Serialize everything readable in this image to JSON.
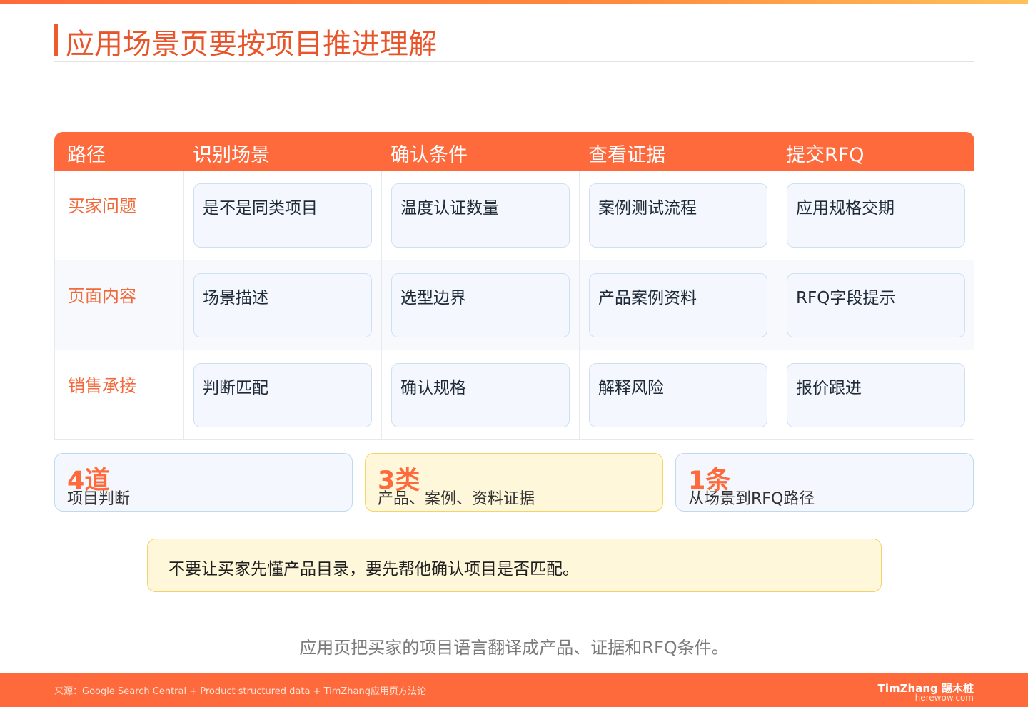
{
  "title": "应用场景页要按项目推进理解",
  "table": {
    "headers": [
      "路径",
      "识别场景",
      "确认条件",
      "查看证据",
      "提交RFQ"
    ],
    "rows": [
      {
        "label": "买家问题",
        "cells": [
          "是不是同类项目",
          "温度认证数量",
          "案例测试流程",
          "应用规格交期"
        ]
      },
      {
        "label": "页面内容",
        "cells": [
          "场景描述",
          "选型边界",
          "产品案例资料",
          "RFQ字段提示"
        ]
      },
      {
        "label": "销售承接",
        "cells": [
          "判断匹配",
          "确认规格",
          "解释风险",
          "报价跟进"
        ]
      }
    ]
  },
  "stats": [
    {
      "number": "4道",
      "desc": "项目判断"
    },
    {
      "number": "3类",
      "desc": "产品、案例、资料证据"
    },
    {
      "number": "1条",
      "desc": "从场景到RFQ路径"
    }
  ],
  "callout": "不要让买家先懂产品目录，要先帮他确认项目是否匹配。",
  "summary": "应用页把买家的项目语言翻译成产品、证据和RFQ条件。",
  "footer": {
    "source": "来源：Google Search Central + Product structured data + TimZhang应用页方法论",
    "brand": "TimZhang 踢木桩",
    "site": "herewow.com"
  },
  "colors": {
    "accent": "#ff6a3d",
    "title": "#e8552a",
    "card_blue": "#f4f8fe",
    "card_yellow": "#fff7d9"
  }
}
